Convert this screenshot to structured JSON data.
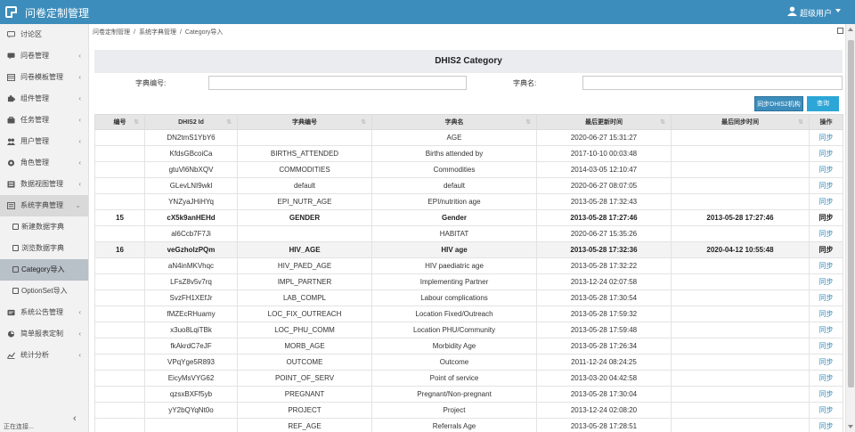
{
  "header": {
    "title": "问卷定制管理",
    "user": "超级用户"
  },
  "sidebar": {
    "items": [
      {
        "label": "讨论区",
        "icon": "chat-icon",
        "arrow": ""
      },
      {
        "label": "问卷管理",
        "icon": "comment-icon",
        "arrow": "‹"
      },
      {
        "label": "问卷模板管理",
        "icon": "template-icon",
        "arrow": "‹"
      },
      {
        "label": "组件管理",
        "icon": "puzzle-icon",
        "arrow": "‹"
      },
      {
        "label": "任务管理",
        "icon": "task-icon",
        "arrow": "‹"
      },
      {
        "label": "用户管理",
        "icon": "users-icon",
        "arrow": "‹"
      },
      {
        "label": "角色管理",
        "icon": "role-icon",
        "arrow": "‹"
      },
      {
        "label": "数据视图管理",
        "icon": "view-icon",
        "arrow": "‹"
      },
      {
        "label": "系统字典管理",
        "icon": "dictionary-icon",
        "arrow": "⌄"
      },
      {
        "label": "新建数据字典",
        "icon": "square-icon",
        "arrow": ""
      },
      {
        "label": "浏览数据字典",
        "icon": "square-icon",
        "arrow": ""
      },
      {
        "label": "Category导入",
        "icon": "square-icon",
        "arrow": ""
      },
      {
        "label": "OptionSet导入",
        "icon": "square-icon",
        "arrow": ""
      },
      {
        "label": "系统公告管理",
        "icon": "notice-icon",
        "arrow": "‹"
      },
      {
        "label": "简单报表定制",
        "icon": "report-icon",
        "arrow": "‹"
      },
      {
        "label": "统计分析",
        "icon": "chart-icon",
        "arrow": "‹"
      }
    ],
    "collapse": "‹",
    "status": "正在连接..."
  },
  "breadcrumb": [
    "问卷定制管理",
    "系统字典管理",
    "Category导入"
  ],
  "panel": {
    "title": "DHIS2 Category",
    "filters": {
      "code_label": "字典编号:",
      "code_value": "",
      "name_label": "字典名:",
      "name_value": ""
    },
    "buttons": {
      "sync": "同步DHIS2机构",
      "query": "查询"
    },
    "columns": [
      "编号",
      "DHIS2 Id",
      "字典编号",
      "字典名",
      "最后更新时间",
      "最后同步时间",
      "操作"
    ],
    "rows": [
      {
        "no": "",
        "id": "DN2tmS1YbY6",
        "code": "",
        "name": "AGE",
        "updated": "2020-06-27 15:31:27",
        "synced": "",
        "op": "同步"
      },
      {
        "no": "",
        "id": "KfdsGBcoiCa",
        "code": "BIRTHS_ATTENDED",
        "name": "Births attended by",
        "updated": "2017-10-10 00:03:48",
        "synced": "",
        "op": "同步"
      },
      {
        "no": "",
        "id": "gtuVl6NbXQV",
        "code": "COMMODITIES",
        "name": "Commodities",
        "updated": "2014-03-05 12:10:47",
        "synced": "",
        "op": "同步"
      },
      {
        "no": "",
        "id": "GLevLNI9wkl",
        "code": "default",
        "name": "default",
        "updated": "2020-06-27 08:07:05",
        "synced": "",
        "op": "同步"
      },
      {
        "no": "",
        "id": "YNZyaJHiHYq",
        "code": "EPI_NUTR_AGE",
        "name": "EPI/nutrition age",
        "updated": "2013-05-28 17:32:43",
        "synced": "",
        "op": "同步"
      },
      {
        "no": "15",
        "id": "cX5k9anHEHd",
        "code": "GENDER",
        "name": "Gender",
        "updated": "2013-05-28 17:27:46",
        "synced": "2013-05-28 17:27:46",
        "op": "同步",
        "bold": true
      },
      {
        "no": "",
        "id": "al6Ccb7F7Ji",
        "code": "",
        "name": "HABITAT",
        "updated": "2020-06-27 15:35:26",
        "synced": "",
        "op": "同步"
      },
      {
        "no": "16",
        "id": "veGzholzPQm",
        "code": "HIV_AGE",
        "name": "HIV age",
        "updated": "2013-05-28 17:32:36",
        "synced": "2020-04-12 10:55:48",
        "op": "同步",
        "bold": true,
        "highlight": true
      },
      {
        "no": "",
        "id": "aN4inMKVhqc",
        "code": "HIV_PAED_AGE",
        "name": "HIV paediatric age",
        "updated": "2013-05-28 17:32:22",
        "synced": "",
        "op": "同步"
      },
      {
        "no": "",
        "id": "LFsZ8v5v7rq",
        "code": "IMPL_PARTNER",
        "name": "Implementing Partner",
        "updated": "2013-12-24 02:07:58",
        "synced": "",
        "op": "同步"
      },
      {
        "no": "",
        "id": "SvzFH1XEfJr",
        "code": "LAB_COMPL",
        "name": "Labour complications",
        "updated": "2013-05-28 17:30:54",
        "synced": "",
        "op": "同步"
      },
      {
        "no": "",
        "id": "fMZEcRHuamy",
        "code": "LOC_FIX_OUTREACH",
        "name": "Location Fixed/Outreach",
        "updated": "2013-05-28 17:59:32",
        "synced": "",
        "op": "同步"
      },
      {
        "no": "",
        "id": "x3uo8LqiTBk",
        "code": "LOC_PHU_COMM",
        "name": "Location PHU/Community",
        "updated": "2013-05-28 17:59:48",
        "synced": "",
        "op": "同步"
      },
      {
        "no": "",
        "id": "fkAkrdC7eJF",
        "code": "MORB_AGE",
        "name": "Morbidity Age",
        "updated": "2013-05-28 17:26:34",
        "synced": "",
        "op": "同步"
      },
      {
        "no": "",
        "id": "VPqYge5R893",
        "code": "OUTCOME",
        "name": "Outcome",
        "updated": "2011-12-24 08:24:25",
        "synced": "",
        "op": "同步"
      },
      {
        "no": "",
        "id": "EicyMsVYG62",
        "code": "POINT_OF_SERV",
        "name": "Point of service",
        "updated": "2013-03-20 04:42:58",
        "synced": "",
        "op": "同步"
      },
      {
        "no": "",
        "id": "qzsxBXFf5yb",
        "code": "PREGNANT",
        "name": "Pregnant/Non-pregnant",
        "updated": "2013-05-28 17:30:04",
        "synced": "",
        "op": "同步"
      },
      {
        "no": "",
        "id": "yY2bQYqNt0o",
        "code": "PROJECT",
        "name": "Project",
        "updated": "2013-12-24 02:08:20",
        "synced": "",
        "op": "同步"
      },
      {
        "no": "",
        "id": "",
        "code": "REF_AGE",
        "name": "Referrals Age",
        "updated": "2013-05-28 17:28:51",
        "synced": "",
        "op": "同步"
      }
    ]
  }
}
